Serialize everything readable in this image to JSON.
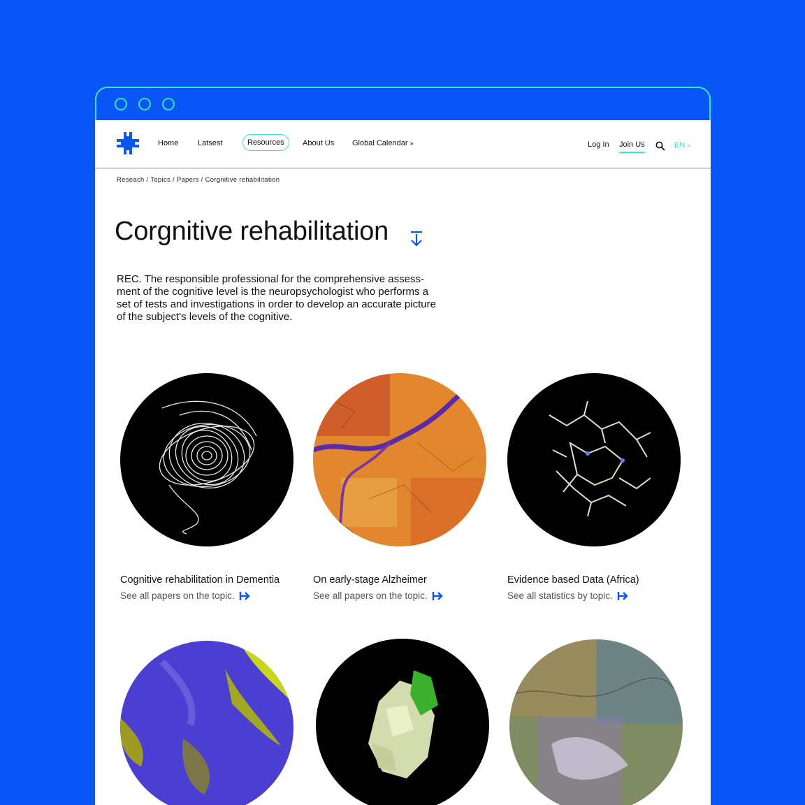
{
  "nav": {
    "items": [
      {
        "label": "Home"
      },
      {
        "label": "Latsest"
      },
      {
        "label": "Resources"
      },
      {
        "label": "About Us"
      },
      {
        "label": "Global Calendar",
        "chevron": "chevron-down-icon"
      }
    ],
    "login_label": "Log In",
    "join_label": "Join Us",
    "lang_label": "EN"
  },
  "breadcrumb": [
    "Reseach",
    "Topics",
    "Papers",
    "Corgnitive rehabilitation"
  ],
  "page": {
    "title": "Corgnitive rehabilitation",
    "description": "REC. The responsible professional for the comprehensive assess-ment of the cognitive level is the neuropsychologist who performs a set of tests and investigations in order to develop an accurate picture of the subject's levels of the cognitive."
  },
  "cards": [
    {
      "title": "Cognitive rehabilitation in Dementia",
      "link": "See all papers on the topic."
    },
    {
      "title": "On early-stage Alzheimer",
      "link": "See all papers on the topic."
    },
    {
      "title": "Evidence based Data (Africa)",
      "link": "See all statistics by topic."
    }
  ],
  "colors": {
    "brand_blue": "#0a55f5",
    "accent_teal": "#2ee6c8"
  }
}
